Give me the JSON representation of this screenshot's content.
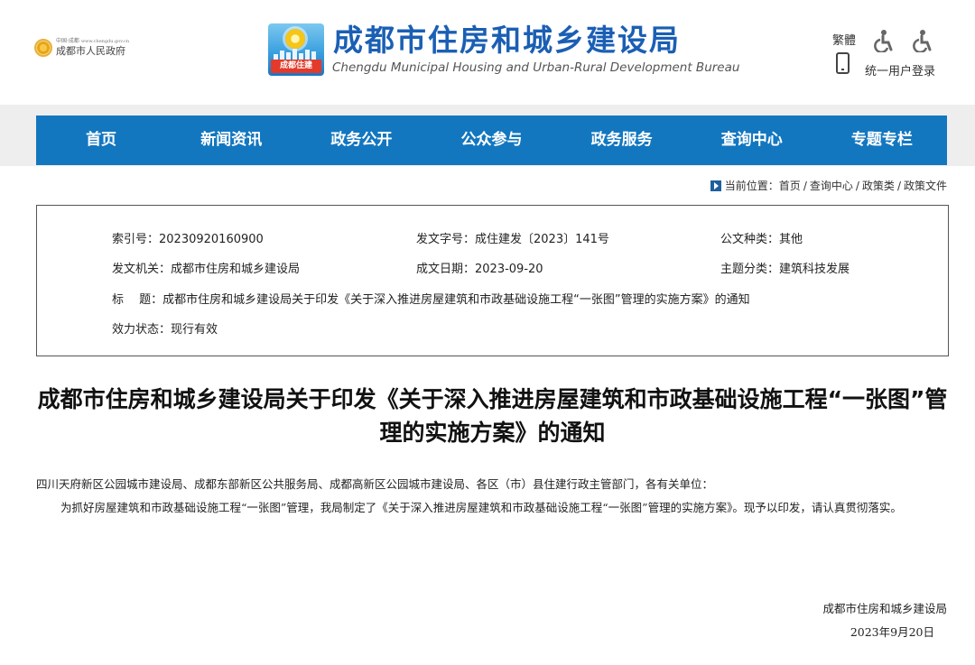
{
  "header": {
    "gov_logo_small": "中国·成都",
    "gov_logo_url_text": "www.chengdu.gov.cn",
    "gov_logo_name": "成都市人民政府",
    "bureau_badge": "成都住建",
    "bureau_name_cn": "成都市住房和城乡建设局",
    "bureau_name_en": "Chengdu Municipal Housing and Urban-Rural Development Bureau",
    "traditional_label": "繁體",
    "login_label": "统一用户登录",
    "brand_color": "#1a5fb4"
  },
  "nav": {
    "color": "#1377c0",
    "items": [
      "首页",
      "新闻资讯",
      "政务公开",
      "公众参与",
      "政务服务",
      "查询中心",
      "专题专栏"
    ]
  },
  "breadcrumb": {
    "prefix": "当前位置：",
    "items": [
      "首页",
      "查询中心",
      "政策类",
      "政策文件"
    ],
    "separator": "/"
  },
  "info": {
    "index_no": "索引号：20230920160900",
    "doc_no": "发文字号：成住建发〔2023〕141号",
    "doc_type": "公文种类：其他",
    "issuer": "发文机关：成都市住房和城乡建设局",
    "date": "成文日期：2023-09-20",
    "topic": "主题分类：建筑科技发展",
    "title": "标　 题：成都市住房和城乡建设局关于印发《关于深入推进房屋建筑和市政基础设施工程“一张图”管理的实施方案》的通知",
    "status": "效力状态：现行有效"
  },
  "document": {
    "title": "成都市住房和城乡建设局关于印发《关于深入推进房屋建筑和市政基础设施工程“一张图”管理的实施方案》的通知",
    "addressee": "四川天府新区公园城市建设局、成都东部新区公共服务局、成都高新区公园城市建设局、各区（市）县住建行政主管部门，各有关单位：",
    "body": "为抓好房屋建筑和市政基础设施工程“一张图”管理，我局制定了《关于深入推进房屋建筑和市政基础设施工程“一张图”管理的实施方案》。现予以印发，请认真贯彻落实。",
    "signature": "成都市住房和城乡建设局",
    "signed_date": "2023年9月20日"
  }
}
